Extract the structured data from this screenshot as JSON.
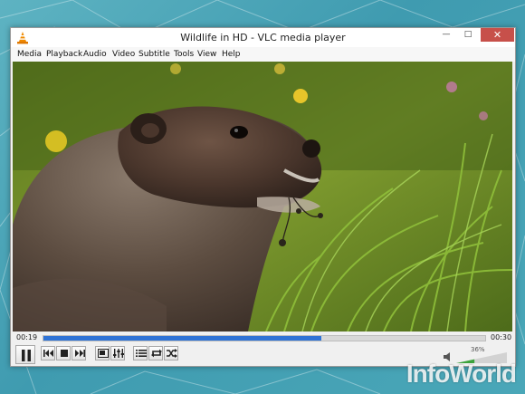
{
  "window": {
    "title": "Wildlife in HD - VLC media player",
    "minimize_glyph": "—",
    "maximize_glyph": "□",
    "close_glyph": "✕"
  },
  "menu": {
    "items": [
      "Media",
      "Playback",
      "Audio",
      "Video",
      "Subtitle",
      "Tools",
      "View",
      "Help"
    ]
  },
  "player": {
    "elapsed": "00:19",
    "total": "00:30",
    "progress": 0.63,
    "volume_text": "36%",
    "volume_level": 0.36
  },
  "icons": {
    "app": "vlc-cone-icon",
    "play_pause": "pause-icon",
    "previous": "previous-icon",
    "stop": "stop-icon",
    "next": "next-icon",
    "fullscreen": "fullscreen-icon",
    "extended_settings": "equalizer-icon",
    "playlist": "playlist-icon",
    "loop": "loop-icon",
    "shuffle": "shuffle-icon",
    "volume": "speaker-icon"
  },
  "colors": {
    "accent": "#2f73d6",
    "close": "#c7504a",
    "vlc_orange": "#f08a00"
  },
  "watermark": "InfoWorld"
}
